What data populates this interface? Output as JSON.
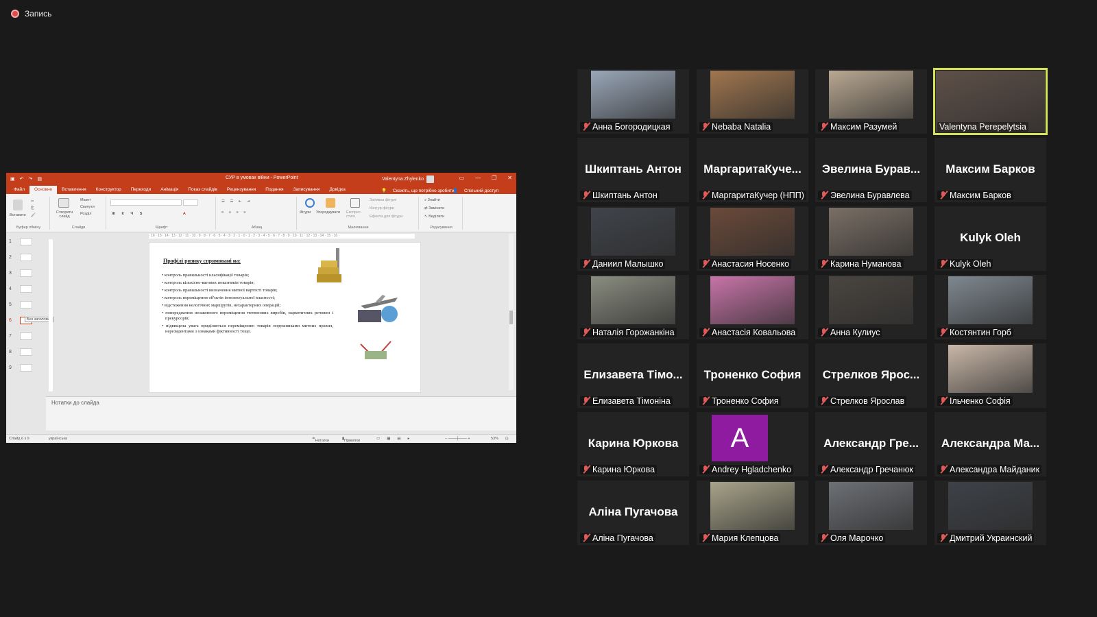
{
  "recording": {
    "label": "Запись"
  },
  "powerpoint": {
    "doc_title": "СУР в умовах війни  -  PowerPoint",
    "user_name": "Valentyna Zhylenko",
    "tabs": [
      "Файл",
      "Основне",
      "Вставлення",
      "Конструктор",
      "Переходи",
      "Анімація",
      "Показ слайдів",
      "Рецензування",
      "Подання",
      "Записування",
      "Довідка"
    ],
    "tell_me": "Скажіть, що потрібно зробити",
    "share_label": "Спільний доступ",
    "ribbon_groups": [
      "Буфер обміну",
      "Слайди",
      "Шрифт",
      "Абзац",
      "Малювання",
      "Редагування"
    ],
    "ribbon_buttons": {
      "paste": "Вставити",
      "new_slide": "Створити слайд",
      "layout": "Макет",
      "reset": "Скинути",
      "section": "Розділ",
      "shapes": "Фігури",
      "arrange": "Упорядкувати",
      "quick_styles": "Експрес-стилі",
      "shape_fill": "Заливка фігури",
      "shape_outline": "Контур фігури",
      "shape_effects": "Ефекти для фігури",
      "find": "Знайти",
      "replace": "Замінити",
      "select": "Виділити"
    },
    "ruler_text": "· 16 · 15 · 14 · 13 · 12 · 11 · 10 · 9 · 8 · 7 · 6 · 5 · 4 · 3 · 2 · 1 · 0 · 1 · 2 · 3 · 4 · 5 · 6 · 7 · 8 · 9 · 10 · 11 · 12 · 13 · 14 · 15 · 16 ·",
    "thumbnails": [
      "1",
      "2",
      "3",
      "4",
      "5",
      "6",
      "7",
      "8",
      "9"
    ],
    "selected_thumbnail": "6",
    "tooltip": "Без заголовка",
    "slide": {
      "heading": "Профілі ризику спрямовані на:",
      "bullets": [
        "контроль правильності класифікації товарів;",
        "контроль кількісно-вагових показників товарів;",
        "контроль правильності визначення митної вартості товарів;",
        "контроль переміщення об'єктів інтелектуальної власності;",
        "відстеження нелогічних маршрутів, нехарактерних операцій;",
        "попередження незаконного переміщення тютюнових виробів, наркотичних речовин і прекурсорів;",
        "підвищена увага приділяється переміщенню товарів порушниками митних правил, нерезидентами з ознаками фіктивності тощо."
      ]
    },
    "notes_placeholder": "Нотатки до слайда",
    "status": {
      "slide_count": "Слайд 6 з 9",
      "language": "українська",
      "notes": "Нотатки",
      "comments": "Примітки",
      "zoom": "53%"
    }
  },
  "participants": [
    {
      "name": "Анна Богородицкая",
      "display": "",
      "video": true,
      "color": "#9aa7b8"
    },
    {
      "name": "Nebaba Natalia",
      "display": "",
      "video": true,
      "color": "#a0764f"
    },
    {
      "name": "Максим Разумей",
      "display": "",
      "video": true,
      "color": "#b9a892"
    },
    {
      "name": "Valentyna Perepelytsia",
      "display": "",
      "video": true,
      "color": "#5e5048",
      "active_speaker": true
    },
    {
      "name": "Шкиптань Антон",
      "display": "Шкиптань Антон",
      "video": false
    },
    {
      "name": "МаргаритаКучер (НПП)",
      "display": "МаргаритаКуче...",
      "video": false
    },
    {
      "name": "Эвелина Буравлева",
      "display": "Эвелина Бурав...",
      "video": false
    },
    {
      "name": "Максим Барков",
      "display": "Максим Барков",
      "video": false
    },
    {
      "name": "Даниил Малышко",
      "display": "",
      "video": true,
      "color": "#40444a"
    },
    {
      "name": "Анастасия Носенко",
      "display": "",
      "video": true,
      "color": "#6b4a3a"
    },
    {
      "name": "Карина Нуманова",
      "display": "",
      "video": true,
      "color": "#7a6f65"
    },
    {
      "name": "Kulyk Oleh",
      "display": "Kulyk Oleh",
      "video": false
    },
    {
      "name": "Наталія Горожанкіна",
      "display": "",
      "video": true,
      "color": "#8a8d80"
    },
    {
      "name": "Анастасія Ковальова",
      "display": "",
      "video": true,
      "color": "#c874a8"
    },
    {
      "name": "Анна Кулиус",
      "display": "",
      "video": true,
      "color": "#4a4540"
    },
    {
      "name": "Костянтин Горб",
      "display": "",
      "video": true,
      "color": "#7f8890"
    },
    {
      "name": "Елизавета Тімоніна",
      "display": "Елизавета Тімо...",
      "video": false
    },
    {
      "name": "Троненко София",
      "display": "Троненко София",
      "video": false
    },
    {
      "name": "Стрелков Ярослав",
      "display": "Стрелков Ярос...",
      "video": false
    },
    {
      "name": "Ільченко Софія",
      "display": "",
      "video": true,
      "color": "#c9b7a8"
    },
    {
      "name": "Карина Юркова",
      "display": "Карина Юркова",
      "video": false
    },
    {
      "name": "Andrey Hgladchenko",
      "display": "",
      "video": false,
      "avatar_letter": "A"
    },
    {
      "name": "Александр Гречанюк",
      "display": "Александр Гре...",
      "video": false
    },
    {
      "name": "Александра Майданик",
      "display": "Александра Ма...",
      "video": false
    },
    {
      "name": "Аліна Пугачова",
      "display": "Аліна Пугачова",
      "video": false
    },
    {
      "name": "Мария Клепцова",
      "display": "",
      "video": true,
      "color": "#a8a48a"
    },
    {
      "name": "Оля Марочко",
      "display": "",
      "video": true,
      "color": "#6d7075"
    },
    {
      "name": "Дмитрий Украинский",
      "display": "",
      "video": true,
      "color": "#3e4248"
    }
  ]
}
